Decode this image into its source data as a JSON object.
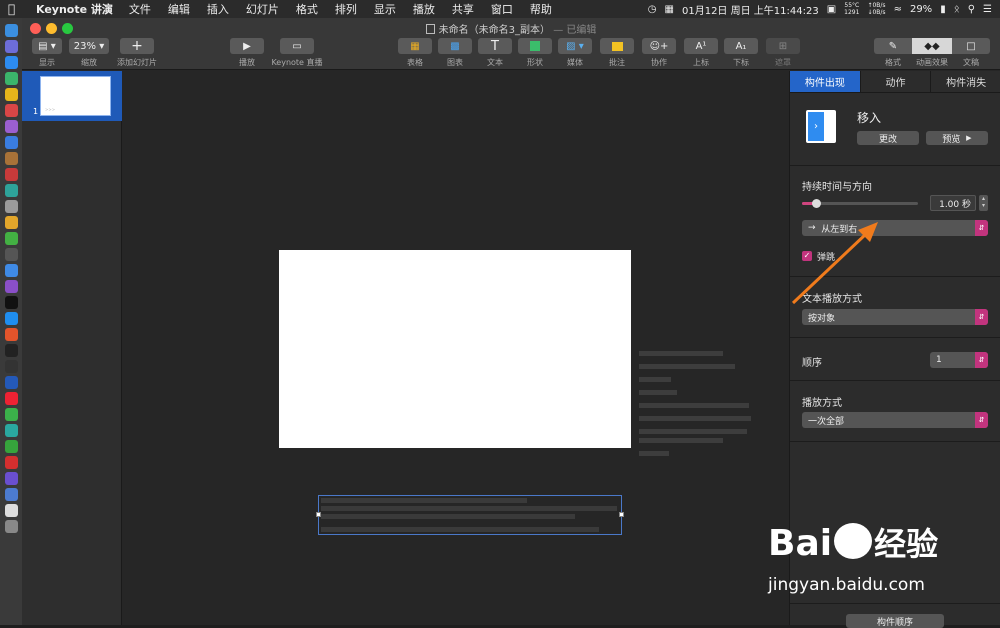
{
  "menubar": {
    "app_name": "Keynote 讲演",
    "menus": [
      "文件",
      "编辑",
      "插入",
      "幻灯片",
      "格式",
      "排列",
      "显示",
      "播放",
      "共享",
      "窗口",
      "帮助"
    ],
    "clock": "01月12日 周日 上午11:44:23",
    "cpu_temp": "55°C",
    "fan": "1291",
    "net_up": "0B/s",
    "net_down": "0B/s",
    "battery": "29%"
  },
  "window": {
    "title": "未命名（未命名3_副本）",
    "title_status": "— 已编辑",
    "zoom_value": "23%",
    "toolbar": {
      "view_label": "显示",
      "zoom_label": "缩放",
      "add_slide_label": "添加幻灯片",
      "play_label": "播放",
      "keynote_live_label": "Keynote 直播",
      "table_label": "表格",
      "chart_label": "图表",
      "text_label": "文本",
      "shape_label": "形状",
      "media_label": "媒体",
      "comment_label": "批注",
      "collaborate_label": "协作",
      "superscript_label": "上标",
      "subscript_label": "下标",
      "mask_label": "遮罩",
      "format_label": "格式",
      "animate_label": "动画效果",
      "document_label": "文稿"
    }
  },
  "navigator": {
    "slide_number": "1",
    "thumb_text": ">>>"
  },
  "inspector": {
    "tabs": [
      "构件出现",
      "动作",
      "构件消失"
    ],
    "effect_name": "移入",
    "change_button": "更改",
    "preview_button": "预览",
    "duration_section": "持续时间与方向",
    "duration_value": "1.00 秒",
    "duration_fraction": 0.12,
    "direction_value": "从左到右",
    "bounce_label": "弹跳",
    "text_delivery_section": "文本播放方式",
    "text_delivery_value": "按对象",
    "order_section": "顺序",
    "order_value": "1",
    "delivery_section": "播放方式",
    "delivery_value": "一次全部",
    "build_order_button": "构件顺序"
  },
  "watermark": {
    "brand": "Bai",
    "brand2": "经验",
    "url": "jingyan.baidu.com"
  },
  "colors": {
    "accent": "#2465c9",
    "select_arrow": "#c2347e",
    "slider": "#d0457f",
    "arrow_annotation": "#f07b1c"
  }
}
